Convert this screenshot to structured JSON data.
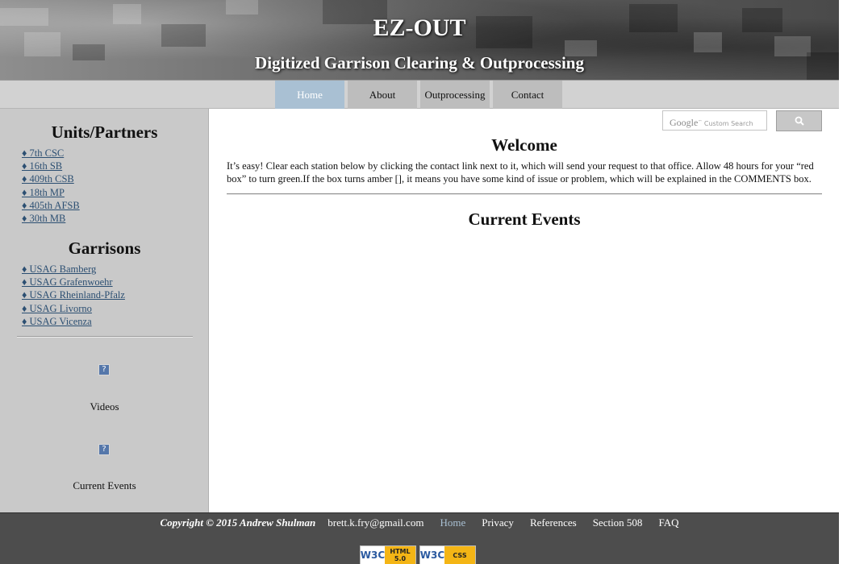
{
  "header": {
    "title": "EZ-OUT",
    "subtitle": "Digitized Garrison Clearing & Outprocessing"
  },
  "nav": {
    "items": [
      {
        "label": "Home",
        "active": true
      },
      {
        "label": "About",
        "active": false
      },
      {
        "label": "Outprocessing",
        "active": false
      },
      {
        "label": "Contact",
        "active": false
      }
    ]
  },
  "sidebar": {
    "units_heading": "Units/Partners",
    "units": [
      "♦ 7th CSC",
      "♦ 16th SB",
      "♦ 409th CSB",
      "♦ 18th MP",
      "♦ 405th AFSB",
      "♦ 30th MB"
    ],
    "garrisons_heading": "Garrisons",
    "garrisons": [
      "♦ USAG Bamberg",
      "♦ USAG Grafenwoehr",
      "♦ USAG Rheinland-Pfalz",
      "♦ USAG Livorno",
      "♦ USAG Vicenza"
    ],
    "videos_caption": "Videos",
    "current_events_caption": "Current Events",
    "broken_image_glyph": "?"
  },
  "search": {
    "brand": "Google",
    "placeholder": "Custom Search",
    "button_icon": "search-icon"
  },
  "main": {
    "welcome_heading": "Welcome",
    "intro_text": "It’s easy! Clear each station below by clicking the contact link next to it, which will send your request to that office. Allow 48 hours for your “red box” to turn green.If the box turns amber [], it means you have some kind of issue or problem, which will be explained in the COMMENTS box.",
    "events_heading": "Current Events"
  },
  "footer": {
    "copyright": "Copyright © 2015 Andrew Shulman",
    "email": "brett.k.fry@gmail.com",
    "links": [
      "Home",
      "Privacy",
      "References",
      "Section 508",
      "FAQ"
    ],
    "badges": [
      {
        "org": "W3C",
        "kind_line1": "HTML",
        "kind_line2": "5.0"
      },
      {
        "org": "W3C",
        "kind_line1": "CSS",
        "kind_line2": ""
      }
    ]
  },
  "colors": {
    "nav_active": "#a9c0d3",
    "link": "#2c4f72",
    "sidebar_bg": "#c9c9c9",
    "footer_bg": "#4d4d4d"
  }
}
